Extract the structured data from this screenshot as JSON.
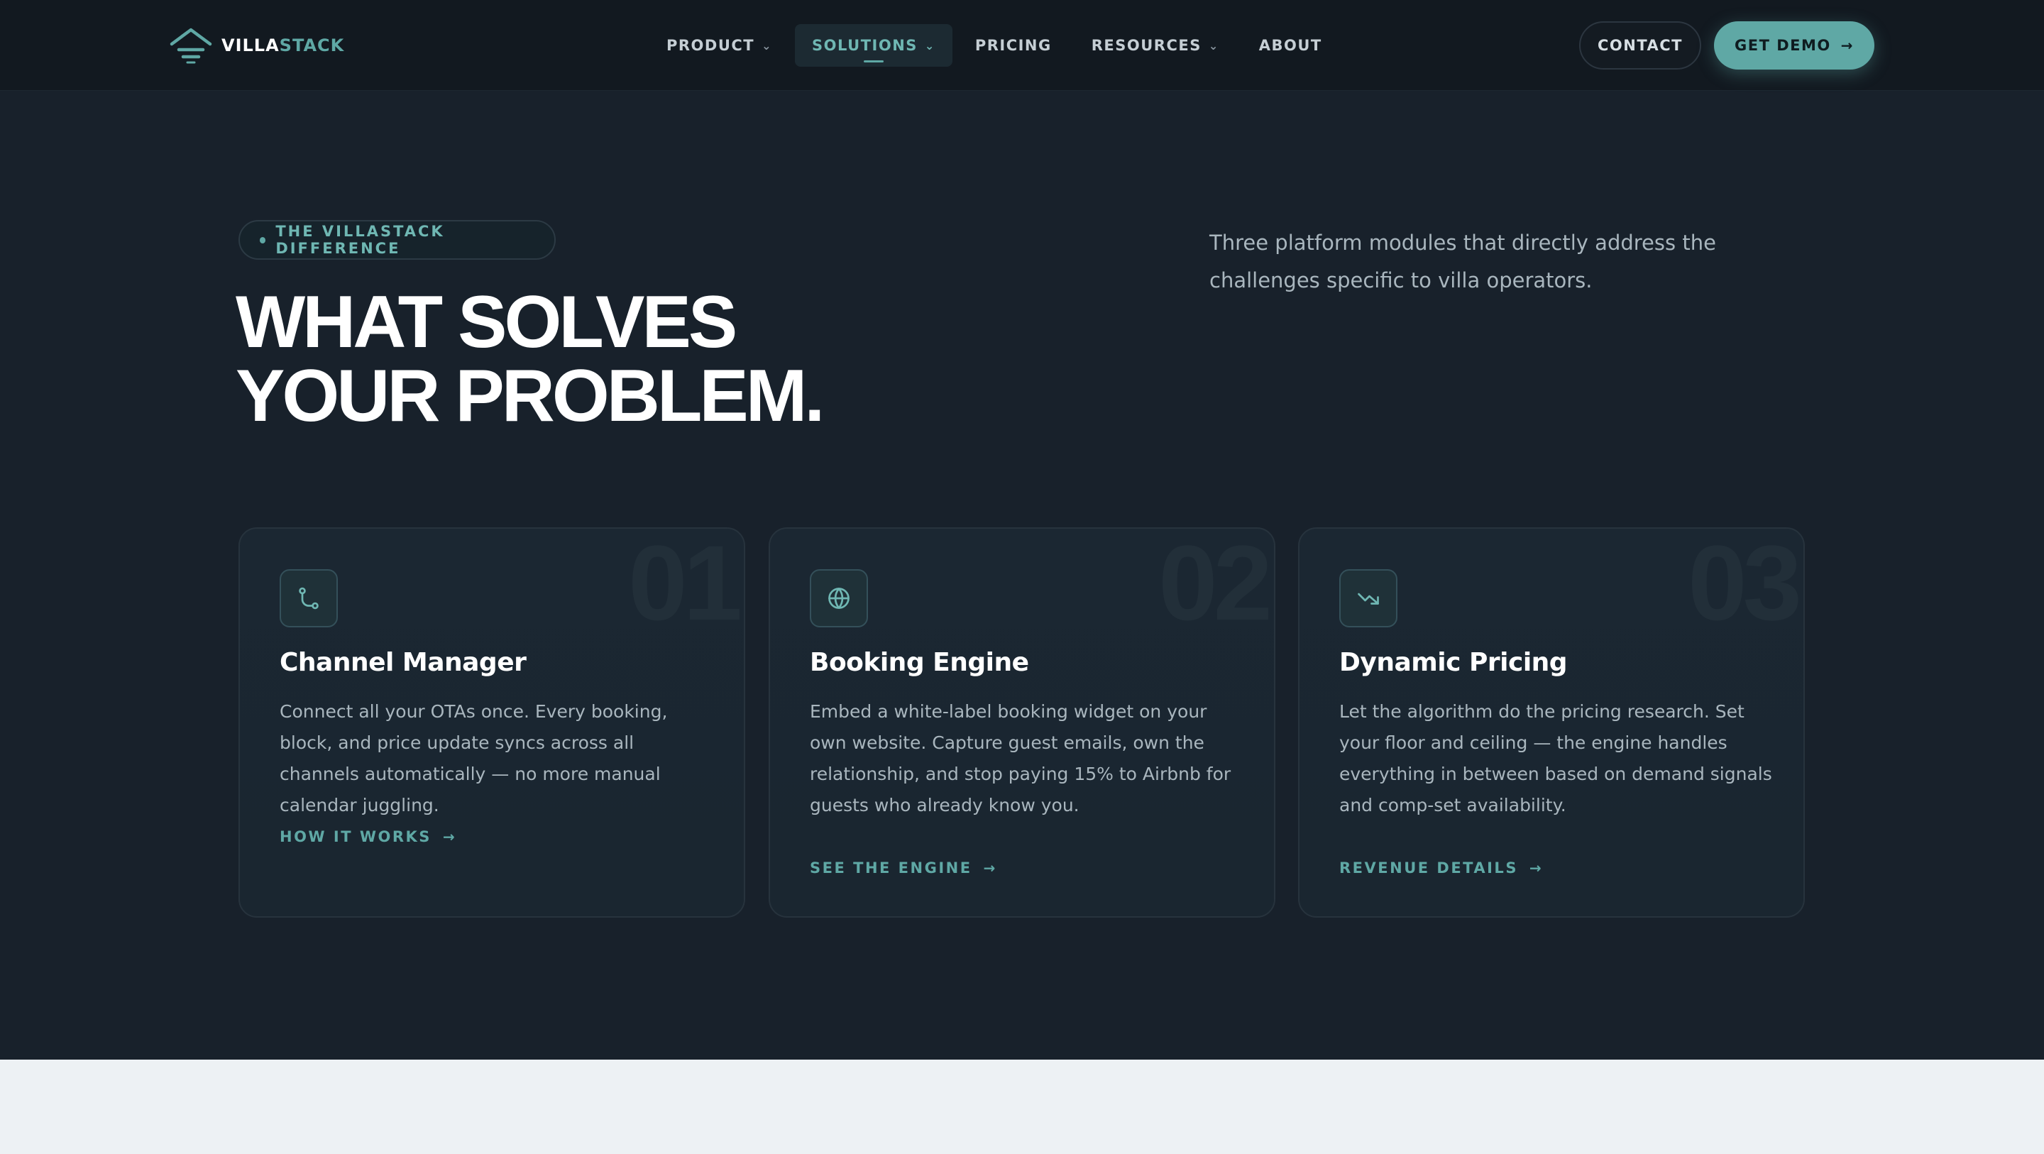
{
  "brand": {
    "name_part1": "VILLA",
    "name_part2": "STACK",
    "accent_color": "#5fa8a5"
  },
  "nav": {
    "items": [
      {
        "label": "PRODUCT",
        "has_dropdown": true,
        "active": false
      },
      {
        "label": "SOLUTIONS",
        "has_dropdown": true,
        "active": true
      },
      {
        "label": "PRICING",
        "has_dropdown": false,
        "active": false
      },
      {
        "label": "RESOURCES",
        "has_dropdown": true,
        "active": false
      },
      {
        "label": "ABOUT",
        "has_dropdown": false,
        "active": false
      }
    ],
    "contact_label": "CONTACT",
    "demo_label": "GET DEMO"
  },
  "hero": {
    "eyebrow": "THE VILLASTACK DIFFERENCE",
    "headline_line1": "WHAT SOLVES",
    "headline_line2": "YOUR PROBLEM.",
    "intro": "Three platform modules that directly address the challenges specific to villa operators."
  },
  "cards": [
    {
      "number": "01",
      "icon": "route-icon",
      "title": "Channel Manager",
      "description": "Connect all your OTAs once. Every booking, block, and price update syncs across all channels automatically — no more manual calendar juggling.",
      "link_label": "HOW IT WORKS"
    },
    {
      "number": "02",
      "icon": "globe-icon",
      "title": "Booking Engine",
      "description": "Embed a white-label booking widget on your own website. Capture guest emails, own the relationship, and stop paying 15% to Airbnb for guests who already know you.",
      "link_label": "SEE THE ENGINE"
    },
    {
      "number": "03",
      "icon": "trending-down-icon",
      "title": "Dynamic Pricing",
      "description": "Let the algorithm do the pricing research. Set your floor and ceiling — the engine handles everything in between based on demand signals and comp-set availability.",
      "link_label": "REVENUE DETAILS"
    }
  ]
}
